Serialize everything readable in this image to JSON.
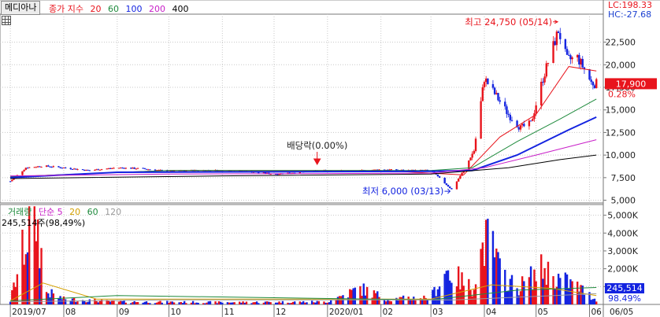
{
  "stock_name": "메디아나",
  "price_legend": {
    "prefix": "종가 지수",
    "periods": [
      {
        "label": "20",
        "color": "#e8141c"
      },
      {
        "label": "60",
        "color": "#1e8a3c"
      },
      {
        "label": "100",
        "color": "#1424e0"
      },
      {
        "label": "200",
        "color": "#c81ec8"
      },
      {
        "label": "400",
        "color": "#000000"
      }
    ]
  },
  "lc_label": "LC:198.33",
  "hc_label": "HC:-27.68",
  "volume_legend": {
    "title": "거래량",
    "sub": "단순 5",
    "periods": [
      {
        "label": "20",
        "color": "#d4a000"
      },
      {
        "label": "60",
        "color": "#1e8a3c"
      },
      {
        "label": "120",
        "color": "#9a9a9a"
      }
    ]
  },
  "volume_info": "245,514주(98,49%)",
  "chart_data": {
    "type": "candlestick",
    "price_axis": {
      "ticks": [
        5000,
        7500,
        10000,
        12500,
        15000,
        17500,
        20000,
        22500
      ],
      "tick_labels": [
        "5,000",
        "7,500",
        "10,000",
        "12,500",
        "15,000",
        "17,500",
        "20,000",
        "22,500"
      ],
      "ylim": [
        4700,
        25600
      ]
    },
    "volume_axis": {
      "ticks": [
        1000,
        2000,
        3000,
        4000,
        5000
      ],
      "tick_labels": [
        "1,000K",
        "2,000K",
        "3,000K",
        "4,000K",
        "5,000K"
      ],
      "ylim": [
        0,
        5600
      ]
    },
    "x_axis_labels": [
      "2019/07",
      "08",
      "09",
      "10",
      "11",
      "12",
      "2020/01",
      "02",
      "03",
      "04",
      "05",
      "06",
      "06/05"
    ],
    "last_price": {
      "label": "17,900",
      "value": 17900,
      "change_label": "0.28%"
    },
    "last_volume": {
      "label": "245,514",
      "pct_label": "98.49%"
    },
    "annotations": [
      {
        "text": "최고 24,750 (05/14)",
        "value": 24750,
        "date": "2020/05/14",
        "type": "high"
      },
      {
        "text": "최저 6,000 (03/13)",
        "value": 6000,
        "date": "2020/03/13",
        "type": "low"
      },
      {
        "text": "배당락(0.00%)",
        "date": "2019/12/26",
        "type": "event"
      }
    ],
    "price_path": [
      [
        "2019/07/01",
        7100
      ],
      [
        "2019/07/10",
        8600
      ],
      [
        "2019/07/20",
        8800
      ],
      [
        "2019/08/01",
        8600
      ],
      [
        "2019/08/15",
        8300
      ],
      [
        "2019/09/01",
        8600
      ],
      [
        "2019/09/15",
        8500
      ],
      [
        "2019/10/01",
        8200
      ],
      [
        "2019/10/15",
        8300
      ],
      [
        "2019/11/01",
        8300
      ],
      [
        "2019/11/15",
        8200
      ],
      [
        "2019/12/01",
        7900
      ],
      [
        "2019/12/15",
        8100
      ],
      [
        "2020/01/01",
        8300
      ],
      [
        "2020/01/15",
        8200
      ],
      [
        "2020/02/01",
        8400
      ],
      [
        "2020/02/15",
        8300
      ],
      [
        "2020/03/01",
        8300
      ],
      [
        "2020/03/13",
        6200
      ],
      [
        "2020/03/20",
        8300
      ],
      [
        "2020/03/26",
        10500
      ],
      [
        "2020/04/01",
        18500
      ],
      [
        "2020/04/08",
        16500
      ],
      [
        "2020/04/15",
        14500
      ],
      [
        "2020/04/22",
        13000
      ],
      [
        "2020/04/28",
        13500
      ],
      [
        "2020/05/05",
        18500
      ],
      [
        "2020/05/10",
        21500
      ],
      [
        "2020/05/14",
        23800
      ],
      [
        "2020/05/19",
        20500
      ],
      [
        "2020/05/25",
        20800
      ],
      [
        "2020/05/29",
        19500
      ],
      [
        "2020/06/02",
        18000
      ],
      [
        "2020/06/05",
        17900
      ]
    ],
    "ma_series": [
      {
        "name": "20",
        "color": "#e8141c",
        "points": [
          [
            "2019/07/01",
            7600
          ],
          [
            "2019/10/01",
            8300
          ],
          [
            "2020/02/01",
            8300
          ],
          [
            "2020/03/20",
            7800
          ],
          [
            "2020/04/10",
            12000
          ],
          [
            "2020/05/01",
            14500
          ],
          [
            "2020/05/20",
            19800
          ],
          [
            "2020/06/05",
            19300
          ]
        ]
      },
      {
        "name": "60",
        "color": "#1e8a3c",
        "points": [
          [
            "2019/07/01",
            7600
          ],
          [
            "2019/10/01",
            8300
          ],
          [
            "2020/03/01",
            8300
          ],
          [
            "2020/03/25",
            8600
          ],
          [
            "2020/04/20",
            11500
          ],
          [
            "2020/05/15",
            14000
          ],
          [
            "2020/06/05",
            16200
          ]
        ]
      },
      {
        "name": "100",
        "color": "#1424e0",
        "points": [
          [
            "2019/07/01",
            7500
          ],
          [
            "2019/09/01",
            8100
          ],
          [
            "2020/03/01",
            8200
          ],
          [
            "2020/03/25",
            8300
          ],
          [
            "2020/04/20",
            10000
          ],
          [
            "2020/05/20",
            12800
          ],
          [
            "2020/06/05",
            14200
          ]
        ]
      },
      {
        "name": "200",
        "color": "#c81ec8",
        "points": [
          [
            "2019/07/01",
            7700
          ],
          [
            "2019/10/01",
            7900
          ],
          [
            "2020/03/01",
            8000
          ],
          [
            "2020/04/01",
            8600
          ],
          [
            "2020/05/01",
            10000
          ],
          [
            "2020/06/05",
            11700
          ]
        ]
      },
      {
        "name": "400",
        "color": "#000000",
        "points": [
          [
            "2019/07/01",
            7400
          ],
          [
            "2019/11/01",
            7700
          ],
          [
            "2020/03/01",
            7900
          ],
          [
            "2020/04/15",
            8600
          ],
          [
            "2020/05/15",
            9500
          ],
          [
            "2020/06/05",
            10000
          ]
        ]
      }
    ],
    "volume_path": [
      [
        "2019/07/01",
        200
      ],
      [
        "2019/07/15",
        5500
      ],
      [
        "2019/07/22",
        700
      ],
      [
        "2019/08/01",
        300
      ],
      [
        "2019/09/01",
        150
      ],
      [
        "2019/11/01",
        120
      ],
      [
        "2020/01/01",
        150
      ],
      [
        "2020/01/20",
        900
      ],
      [
        "2020/02/05",
        300
      ],
      [
        "2020/03/01",
        400
      ],
      [
        "2020/03/10",
        1900
      ],
      [
        "2020/03/25",
        900
      ],
      [
        "2020/04/01",
        3500
      ],
      [
        "2020/04/06",
        3200
      ],
      [
        "2020/04/10",
        1800
      ],
      [
        "2020/04/20",
        900
      ],
      [
        "2020/05/05",
        2000
      ],
      [
        "2020/05/15",
        1400
      ],
      [
        "2020/05/25",
        1000
      ],
      [
        "2020/06/05",
        245
      ]
    ]
  }
}
